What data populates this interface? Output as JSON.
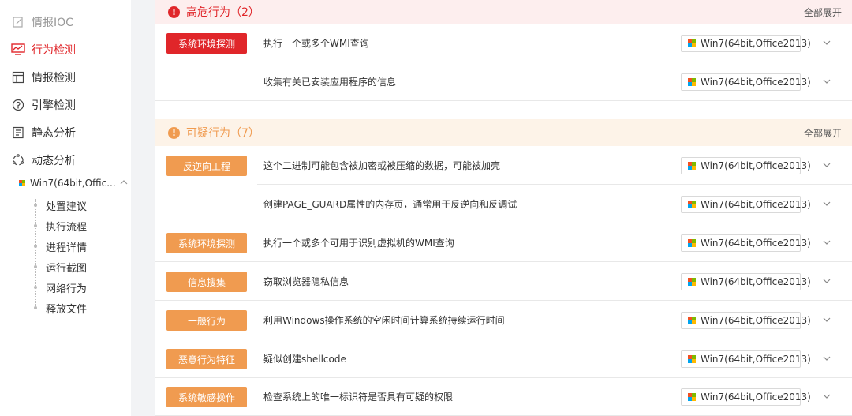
{
  "sidebar": {
    "items": [
      {
        "label": "情报IOC",
        "icon": "edit-icon"
      },
      {
        "label": "行为检测",
        "icon": "monitor-icon"
      },
      {
        "label": "情报检测",
        "icon": "layout-icon"
      },
      {
        "label": "引擎检测",
        "icon": "engine-icon"
      },
      {
        "label": "静态分析",
        "icon": "document-icon"
      },
      {
        "label": "动态分析",
        "icon": "cycle-icon"
      }
    ],
    "env_head": "Win7(64bit,Offic...",
    "sub_items": [
      "处置建议",
      "执行流程",
      "进程详情",
      "运行截图",
      "网络行为",
      "释放文件"
    ]
  },
  "high": {
    "title": "高危行为（2）",
    "expand": "全部展开",
    "color": "#e0262a",
    "rows": [
      {
        "tag": "系统环境探测",
        "desc": "执行一个或多个WMI查询",
        "env": "Win7(64bit,Office2013)"
      },
      {
        "tag": "",
        "desc": "收集有关已安装应用程序的信息",
        "env": "Win7(64bit,Office2013)"
      }
    ]
  },
  "suspicious": {
    "title": "可疑行为（7）",
    "expand": "全部展开",
    "color": "#f09b50",
    "rows": [
      {
        "tag": "反逆向工程",
        "desc": "这个二进制可能包含被加密或被压缩的数据，可能被加壳",
        "env": "Win7(64bit,Office2013)"
      },
      {
        "tag": "",
        "desc": "创建PAGE_GUARD属性的内存页，通常用于反逆向和反调试",
        "env": "Win7(64bit,Office2013)"
      },
      {
        "tag": "系统环境探测",
        "desc": "执行一个或多个可用于识别虚拟机的WMI查询",
        "env": "Win7(64bit,Office2013)"
      },
      {
        "tag": "信息搜集",
        "desc": "窃取浏览器隐私信息",
        "env": "Win7(64bit,Office2013)"
      },
      {
        "tag": "一般行为",
        "desc": "利用Windows操作系统的空闲时间计算系统持续运行时间",
        "env": "Win7(64bit,Office2013)"
      },
      {
        "tag": "恶意行为特征",
        "desc": "疑似创建shellcode",
        "env": "Win7(64bit,Office2013)"
      },
      {
        "tag": "系统敏感操作",
        "desc": "检查系统上的唯一标识符是否具有可疑的权限",
        "env": "Win7(64bit,Office2013)"
      }
    ]
  }
}
